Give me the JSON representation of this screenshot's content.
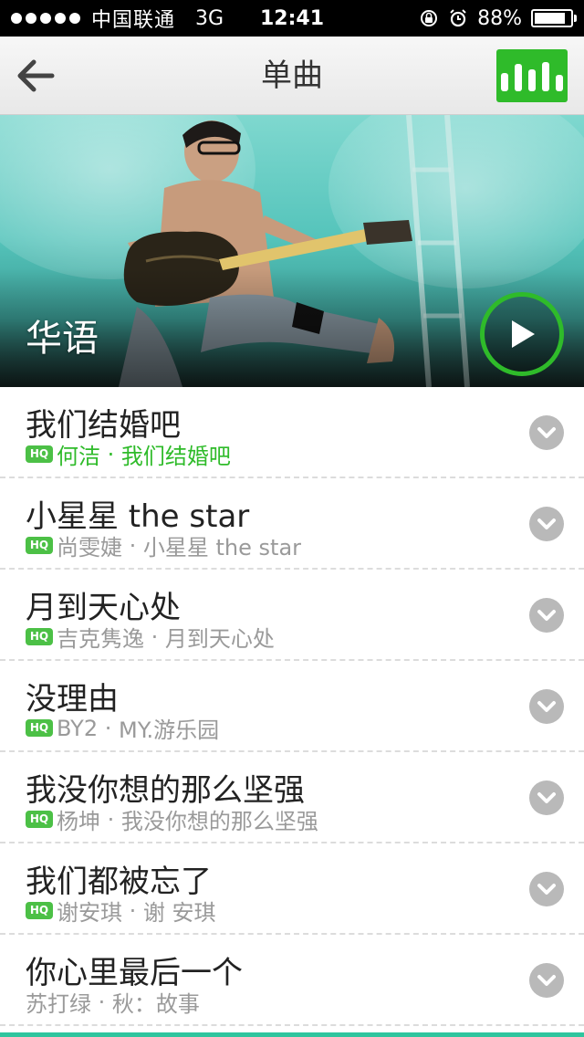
{
  "status_bar": {
    "carrier": "中国联通",
    "network": "3G",
    "time": "12:41",
    "battery": "88%",
    "battery_level": 0.88
  },
  "nav": {
    "title": "单曲",
    "accent_color": "#2fbb2a"
  },
  "banner": {
    "title": "华语"
  },
  "songs": [
    {
      "title": "我们结婚吧",
      "artist": "何洁",
      "album": "我们结婚吧",
      "hq": true,
      "active": true
    },
    {
      "title": "小星星 the star",
      "artist": "尚雯婕",
      "album": "小星星 the star",
      "hq": true,
      "active": false
    },
    {
      "title": "月到天心处",
      "artist": "吉克隽逸",
      "album": "月到天心处",
      "hq": true,
      "active": false
    },
    {
      "title": "没理由",
      "artist": "BY2",
      "album": "MY.游乐园",
      "hq": true,
      "active": false
    },
    {
      "title": "我没你想的那么坚强",
      "artist": "杨坤",
      "album": "我没你想的那么坚强",
      "hq": true,
      "active": false
    },
    {
      "title": "我们都被忘了",
      "artist": "谢安琪",
      "album": "谢 安琪",
      "hq": true,
      "active": false
    },
    {
      "title": "你心里最后一个",
      "artist": "苏打绿",
      "album": "秋：故事",
      "hq": false,
      "active": false
    }
  ],
  "labels": {
    "hq_badge": "HQ",
    "separator": " · "
  },
  "icons": {
    "back": "back-arrow-icon",
    "chart": "bar-chart-icon",
    "play": "play-icon",
    "more": "chevron-down-icon"
  }
}
